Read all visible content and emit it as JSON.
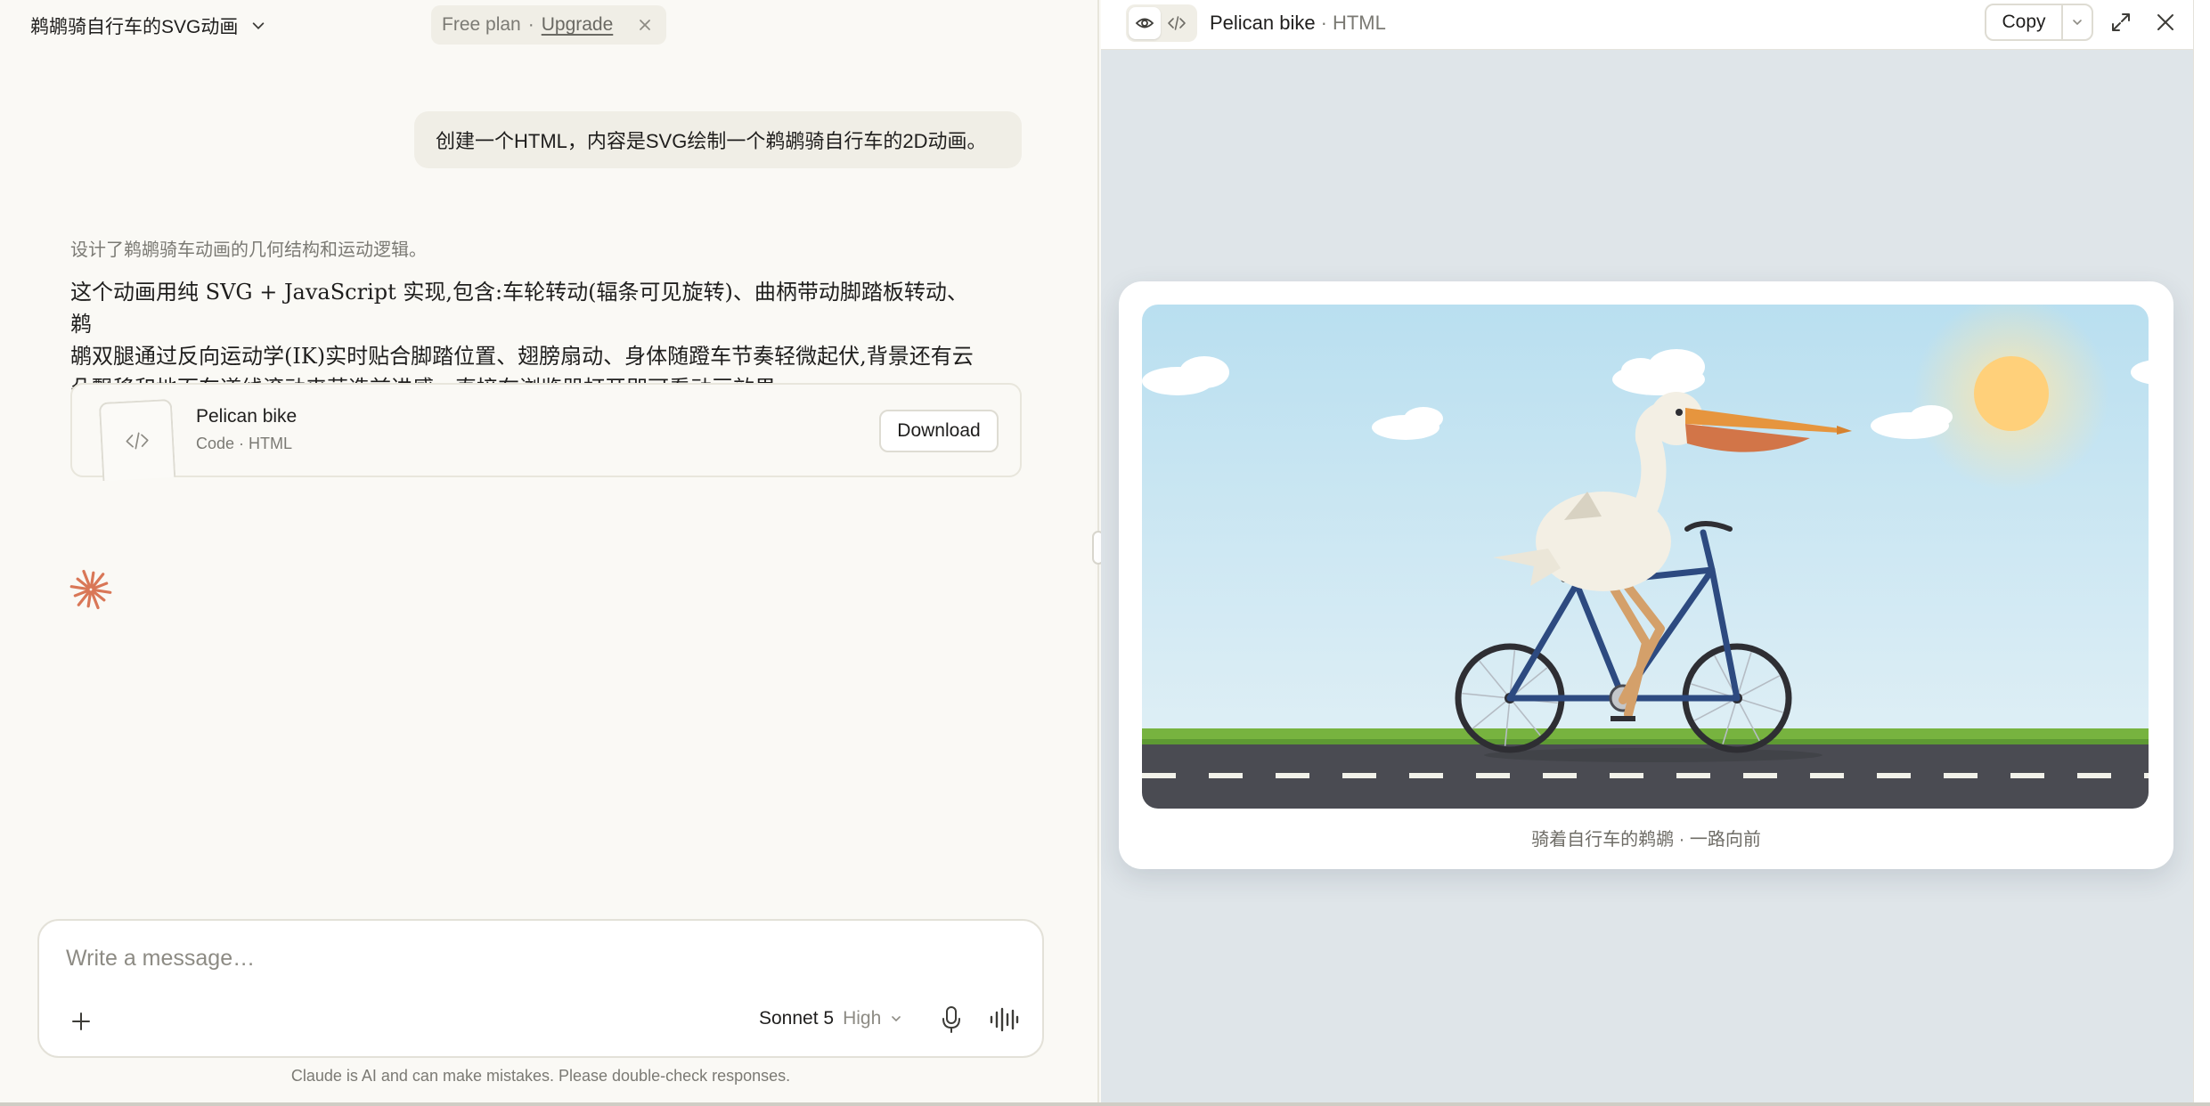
{
  "chat": {
    "title": "鹈鹕骑自行车的SVG动画",
    "plan": {
      "label": "Free plan",
      "separator": "·",
      "upgrade": "Upgrade"
    },
    "user_message": "创建一个HTML，内容是SVG绘制一个鹈鹕骑自行车的2D动画。",
    "thinking_summary": "设计了鹈鹕骑车动画的几何结构和运动逻辑。",
    "reply_lines": [
      "这个动画用纯 SVG + JavaScript 实现,包含:车轮转动(辐条可见旋转)、曲柄带动脚踏板转动、鹈",
      "鹕双腿通过反向运动学(IK)实时贴合脚踏位置、翅膀扇动、身体随蹬车节奏轻微起伏,背景还有云",
      "朵飘移和地面车道线滚动来营造前进感。直接在浏览器打开即可看动画效果。"
    ],
    "artifact": {
      "name": "Pelican bike",
      "meta": "Code · HTML",
      "download_label": "Download"
    },
    "composer": {
      "placeholder": "Write a message…",
      "model": "Sonnet 5",
      "effort": "High"
    },
    "disclaimer": "Claude is AI and can make mistakes. Please double-check responses."
  },
  "artifact_panel": {
    "title": "Pelican bike",
    "separator": "·",
    "kind": "HTML",
    "copy_label": "Copy",
    "caption": "骑着自行车的鹈鹕 · 一路向前"
  },
  "colors": {
    "accent_spark": "#d97757",
    "sky_top": "#b9dff0",
    "sky_bottom": "#e4f1f6",
    "sun": "#ffd07a",
    "grass": "#77b33f",
    "road": "#4a4b52",
    "bike_frame": "#2d4a80",
    "pelican_body": "#f3efe4",
    "beak": "#e6953e",
    "pouch": "#d27548",
    "legs": "#d4a06a"
  },
  "icons": {
    "title_menu": "chevron-down-icon",
    "plan_close": "close-icon",
    "artifact_thumb": "code-icon",
    "thinking_spark": "claude-spark-icon",
    "composer_add": "plus-icon",
    "model_menu": "chevron-down-icon",
    "mic": "microphone-icon",
    "voice": "voice-waveform-icon",
    "preview": "eye-icon",
    "code": "code-icon",
    "copy_menu": "chevron-down-icon",
    "expand": "expand-icon",
    "close": "close-icon"
  }
}
